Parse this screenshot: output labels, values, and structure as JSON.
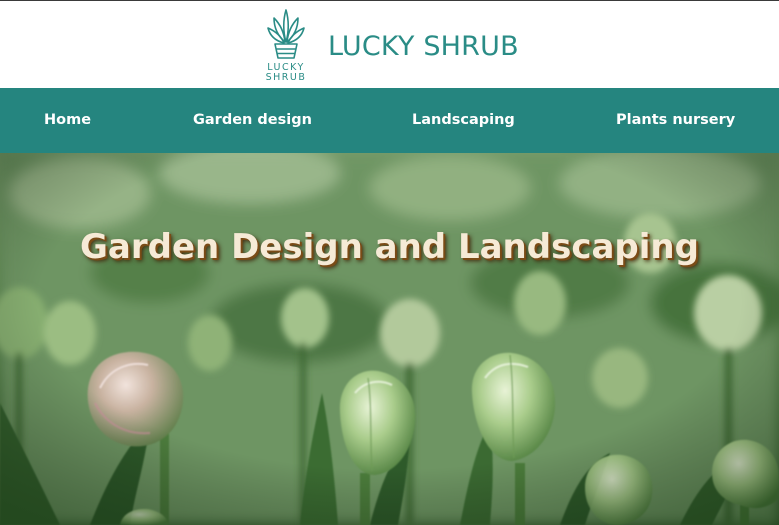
{
  "header": {
    "logo": {
      "line1": "LUCKY",
      "line2": "SHRUB",
      "icon": "succulent-pot-icon"
    },
    "brand_name": "LUCKY SHRUB"
  },
  "nav": {
    "items": [
      {
        "label": "Home"
      },
      {
        "label": "Garden design"
      },
      {
        "label": "Landscaping"
      },
      {
        "label": "Plants nursery"
      }
    ]
  },
  "hero": {
    "title": "Garden Design and Landscaping",
    "image": "tulip-buds-field-image"
  },
  "colors": {
    "brand": "#2a8c86",
    "nav_background": "#25857f",
    "nav_text": "#ffffff",
    "hero_title": "#f6ead6",
    "hero_title_shadow": "#7a4b16"
  }
}
